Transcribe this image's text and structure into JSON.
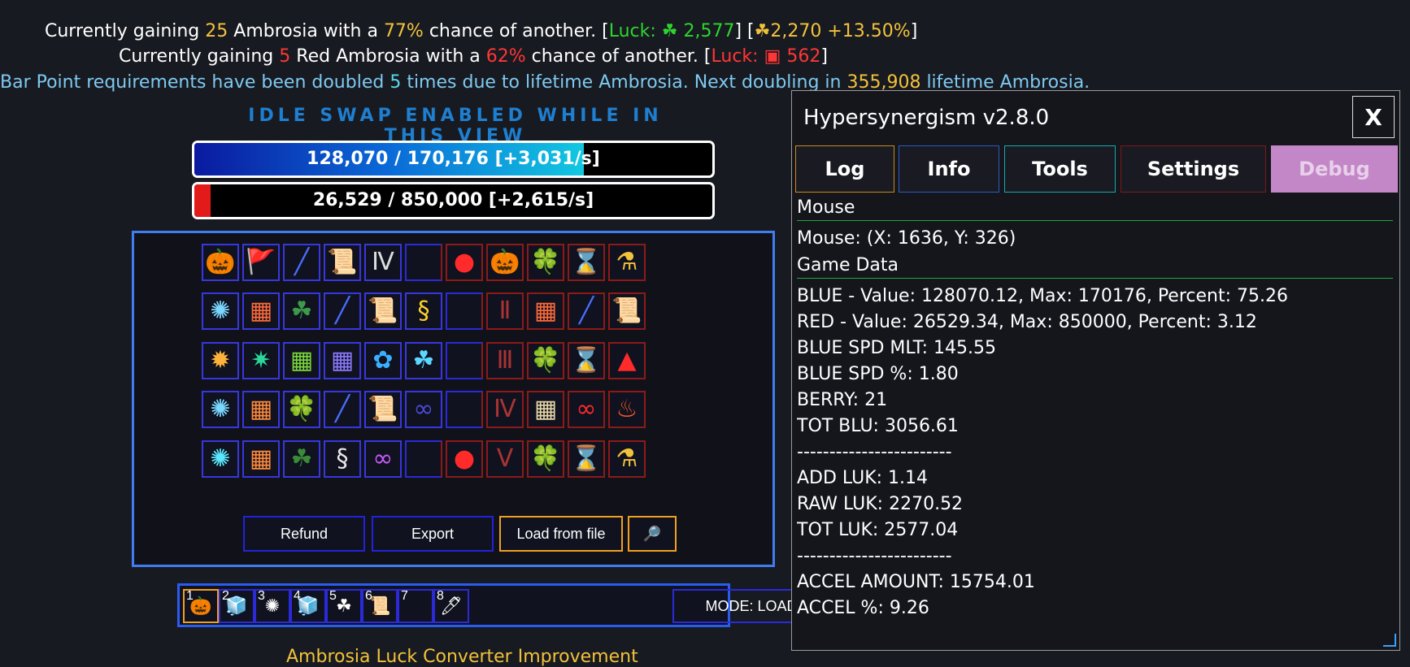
{
  "top": {
    "line1": {
      "a": "Currently gaining ",
      "n": "25",
      "b": " Ambrosia with a ",
      "p": "77%",
      "c": " chance of another. [",
      "luck": "Luck: ☘ 2,577",
      "d": "] [",
      "raw": "☘2,270 +13.50%",
      "e": "]"
    },
    "line2": {
      "a": "Currently gaining ",
      "n": "5",
      "b": " Red Ambrosia with a ",
      "p": "62%",
      "c": " chance of another. [",
      "luck": "Luck: ▣ 562",
      "e": "]"
    },
    "line3": {
      "a": "Bar Point requirements have been doubled ",
      "n": "5",
      "b": " times due to lifetime Ambrosia. Next doubling in ",
      "v": "355,908",
      "c": " lifetime Ambrosia."
    },
    "idle": "IDLE SWAP ENABLED WHILE IN THIS VIEW"
  },
  "bars": {
    "blue": {
      "text": "128,070 / 170,176 [+3,031/s]",
      "fill_percent": 75.26,
      "color": "#1a5ee0"
    },
    "red": {
      "text": "26,529 / 850,000 [+2,615/s]",
      "fill_percent": 3.12,
      "color": "#e21a1a"
    }
  },
  "grid": {
    "rows": [
      [
        "pumpkin",
        "flag",
        "wand",
        "scroll",
        "numeral",
        "empty",
        "red-blob",
        "pumpkin-r",
        "clover",
        "hourglass",
        "flask"
      ],
      [
        "orb",
        "cubes",
        "clover-s",
        "wand",
        "scroll",
        "snake",
        "empty",
        "pillar",
        "cubes",
        "wand",
        "scroll"
      ],
      [
        "orb2",
        "orb-g",
        "cubes-g",
        "cubes-b",
        "leaf",
        "clover-b",
        "empty",
        "pillar3",
        "clover",
        "hourglass-r",
        "flame"
      ],
      [
        "orb",
        "cubes-o",
        "clover",
        "wand",
        "scroll",
        "infinity",
        "empty",
        "pillar4",
        "cubes-w",
        "infinity-r",
        "fire"
      ],
      [
        "orb3",
        "cubes-o",
        "clover-d",
        "snake-s",
        "infinity-p",
        "empty",
        "red-blob",
        "pillar5",
        "clover",
        "hourglass",
        "flask"
      ]
    ],
    "buttons": {
      "refund": "Refund",
      "export": "Export",
      "load": "Load from file",
      "search": "🔎"
    }
  },
  "loadout": {
    "slots": [
      {
        "n": "1",
        "icon": "🎃"
      },
      {
        "n": "2",
        "icon": "🧊"
      },
      {
        "n": "3",
        "icon": "✺"
      },
      {
        "n": "4",
        "icon": "🧊"
      },
      {
        "n": "5",
        "icon": "☘"
      },
      {
        "n": "6",
        "icon": "📜"
      },
      {
        "n": "7",
        "icon": ""
      },
      {
        "n": "8",
        "icon": "🖊"
      }
    ],
    "mode": "MODE: LOAD LOADOUT"
  },
  "bottom": "Ambrosia Luck Converter Improvement",
  "panel": {
    "title": "Hypersynergism v2.8.0",
    "close": "X",
    "tabs": [
      {
        "label": "Log",
        "color": "#c88a1c"
      },
      {
        "label": "Info",
        "color": "#2a5bbf"
      },
      {
        "label": "Tools",
        "color": "#1aa8b0"
      },
      {
        "label": "Settings",
        "color": "#7a1a1a"
      },
      {
        "label": "Debug",
        "color": "#c386c7"
      }
    ],
    "sections": {
      "mouse": "Mouse",
      "game": "Game Data"
    },
    "mouse_line": "Mouse: (X: 1636, Y: 326)",
    "rows": [
      "BLUE - Value: 128070.12, Max: 170176, Percent: 75.26",
      "RED - Value: 26529.34, Max: 850000, Percent: 3.12",
      "BLUE SPD MLT: 145.55",
      "BLUE SPD %: 1.80",
      "BERRY: 21",
      "TOT BLU: 3056.61",
      "------------------------",
      "ADD LUK: 1.14",
      "RAW LUK: 2270.52",
      "TOT LUK: 2577.04",
      "------------------------",
      "ACCEL AMOUNT: 15754.01",
      "ACCEL %: 9.26"
    ]
  }
}
